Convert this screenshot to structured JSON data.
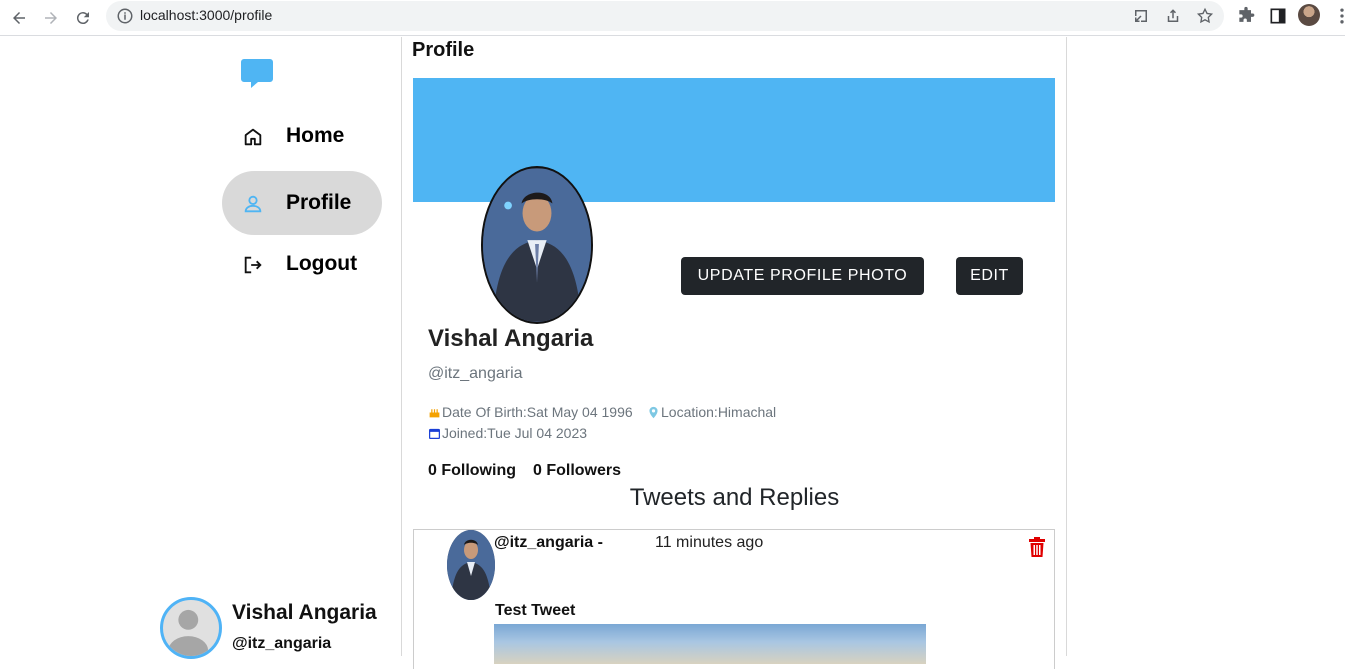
{
  "browser": {
    "url": "localhost:3000/profile"
  },
  "sidebar": {
    "items": [
      {
        "label": "Home",
        "icon": "home-icon"
      },
      {
        "label": "Profile",
        "icon": "user-icon"
      },
      {
        "label": "Logout",
        "icon": "logout-icon"
      }
    ],
    "user": {
      "name": "Vishal Angaria",
      "handle": "@itz_angaria"
    }
  },
  "main": {
    "title": "Profile",
    "buttons": {
      "update_photo": "UPDATE PROFILE PHOTO",
      "edit": "EDIT"
    },
    "profile": {
      "name": "Vishal Angaria",
      "handle": "@itz_angaria",
      "dob": "Date Of Birth:Sat May 04 1996",
      "location": "Location:Himachal",
      "joined": "Joined:Tue Jul 04 2023",
      "following": "0 Following",
      "followers": "0 Followers"
    },
    "section_title": "Tweets and Replies",
    "tweets": [
      {
        "handle": "@itz_angaria -",
        "time": "11 minutes ago",
        "text": "Test Tweet"
      }
    ]
  },
  "colors": {
    "accent": "#4fb5f3",
    "button_dark": "#212529",
    "active_nav_bg": "#d9d9d9",
    "delete": "#e00000"
  }
}
